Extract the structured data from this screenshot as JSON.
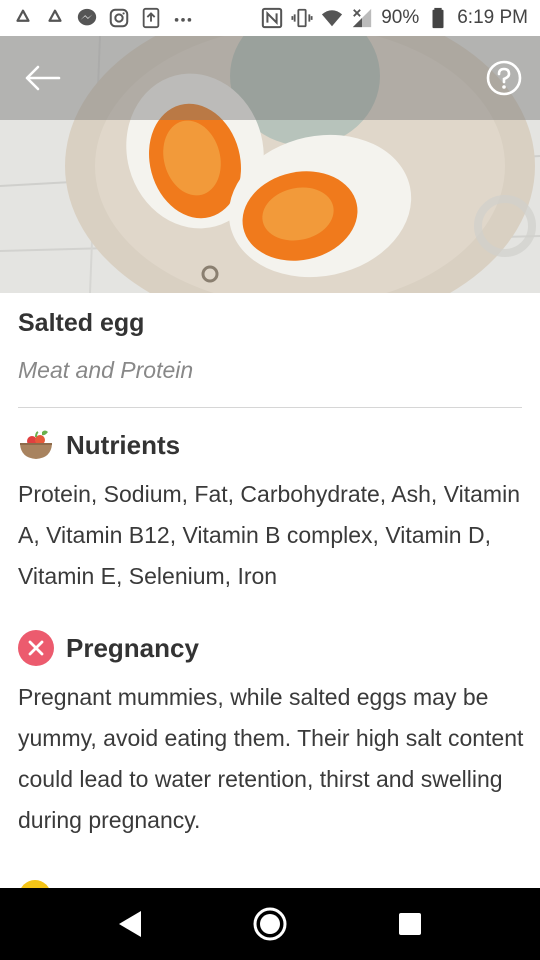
{
  "status_bar": {
    "battery": "90%",
    "time": "6:19 PM",
    "left_icons": [
      "recycle-icon",
      "recycle-icon",
      "messenger-icon",
      "instagram-icon",
      "upload-icon",
      "more-icon"
    ],
    "right_icons": [
      "nfc-icon",
      "vibrate-icon",
      "wifi-icon",
      "signal-icon",
      "battery-icon"
    ]
  },
  "header": {
    "back_icon": "arrow-left-icon",
    "help_icon": "help-circle-icon"
  },
  "food": {
    "name": "Salted egg",
    "category": "Meat and Protein"
  },
  "sections": [
    {
      "icon": "food-bowl-icon",
      "title": "Nutrients",
      "text": "Protein, Sodium, Fat, Carbohydrate, Ash, Vitamin A, Vitamin B12, Vitamin B complex, Vitamin D, Vitamin E, Selenium, Iron"
    },
    {
      "icon": "x-circle-icon",
      "title": "Pregnancy",
      "text": "Pregnant mummies, while salted eggs may be yummy, avoid eating them. Their high salt content could lead to water retention, thirst and swelling during pregnancy."
    }
  ],
  "colors": {
    "warning_red": "#ec5b6e",
    "yolk": "#f07a1c",
    "partial_icon_yellow": "#f5c518"
  },
  "nav": {
    "back_icon": "nav-back-icon",
    "home_icon": "nav-home-icon",
    "recents_icon": "nav-recents-icon"
  }
}
